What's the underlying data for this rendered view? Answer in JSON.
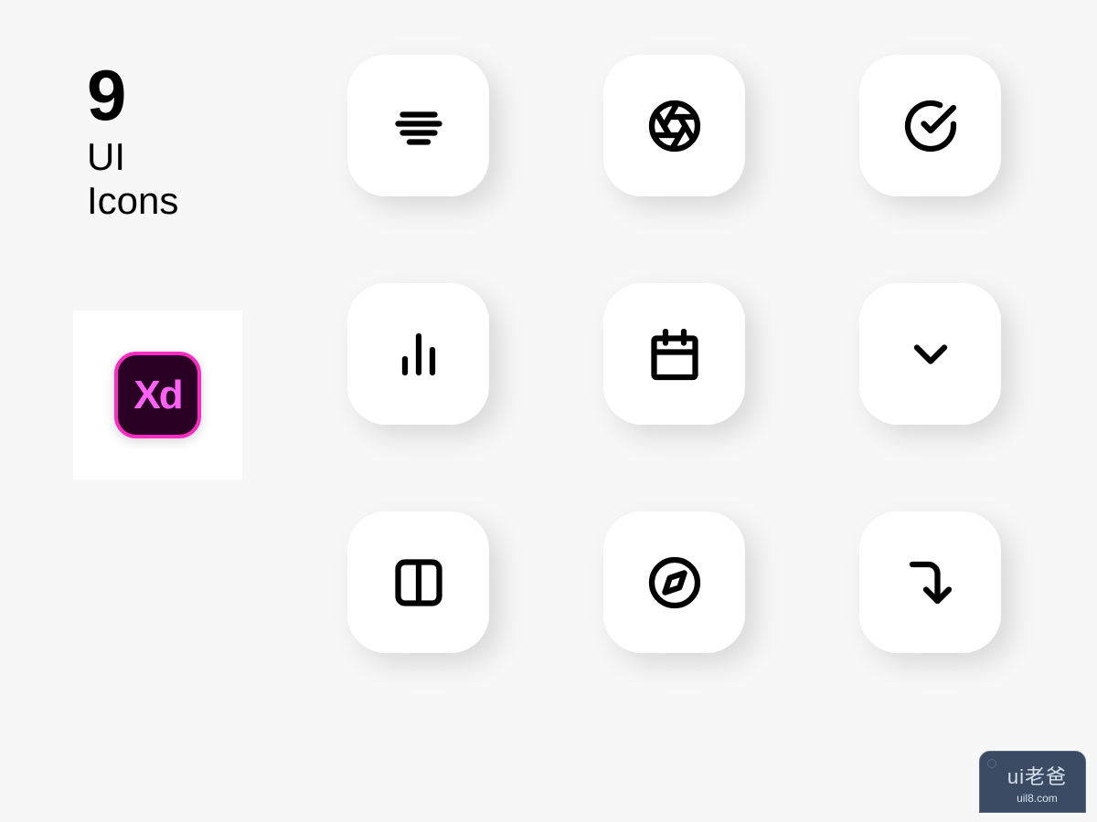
{
  "header": {
    "count": "9",
    "title_line1": "UI",
    "title_line2": "Icons"
  },
  "app_badge": {
    "name": "Adobe XD",
    "label": "Xd"
  },
  "icons": [
    {
      "name": "center-align-icon"
    },
    {
      "name": "aperture-icon"
    },
    {
      "name": "check-circle-icon"
    },
    {
      "name": "bar-chart-icon"
    },
    {
      "name": "calendar-icon"
    },
    {
      "name": "chevron-down-icon"
    },
    {
      "name": "columns-icon"
    },
    {
      "name": "compass-icon"
    },
    {
      "name": "corner-right-down-icon"
    }
  ],
  "watermark": {
    "brand": "ui老爸",
    "url": "uil8.com"
  }
}
